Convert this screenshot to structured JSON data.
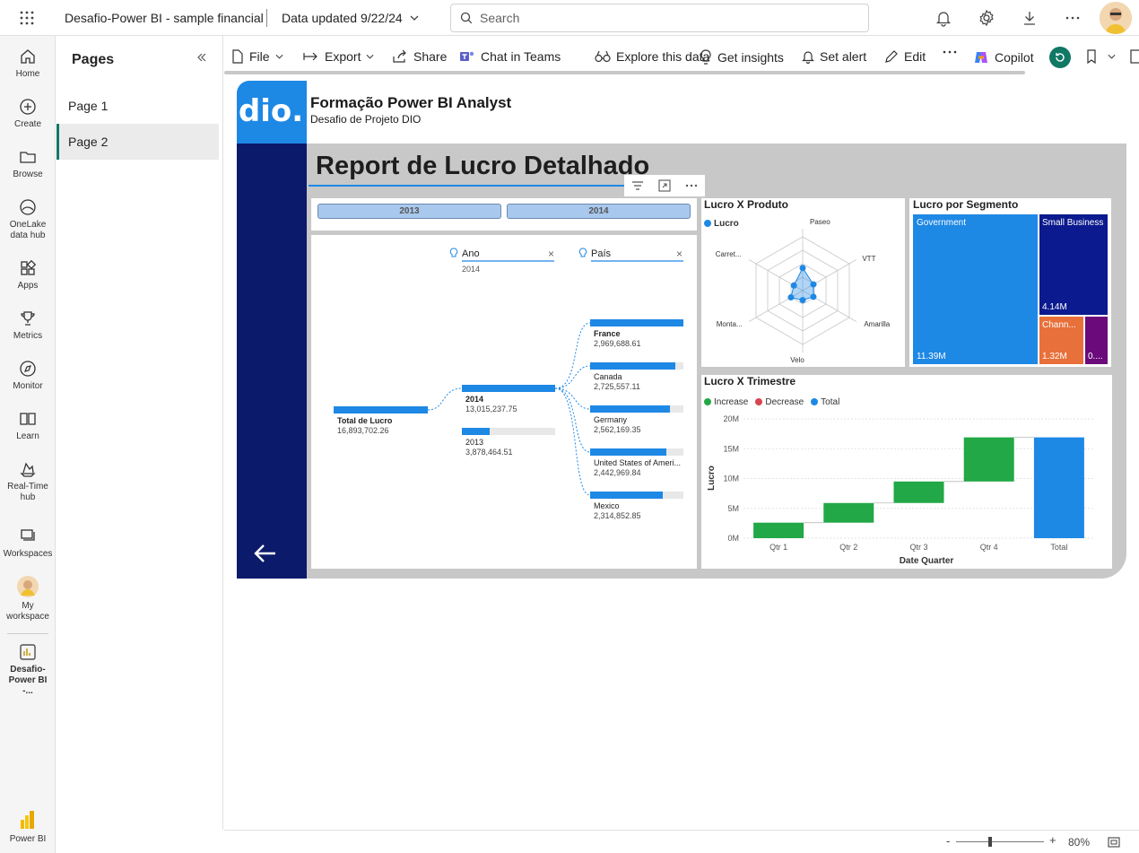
{
  "header": {
    "app_title": "Desafio-Power BI - sample financial",
    "data_updated": "Data updated 9/22/24",
    "search_placeholder": "Search"
  },
  "leftnav": {
    "items": [
      {
        "label": "Home"
      },
      {
        "label": "Create"
      },
      {
        "label": "Browse"
      },
      {
        "label": "OneLake data hub"
      },
      {
        "label": "Apps"
      },
      {
        "label": "Metrics"
      },
      {
        "label": "Monitor"
      },
      {
        "label": "Learn"
      },
      {
        "label": "Real-Time hub"
      },
      {
        "label": "Workspaces"
      },
      {
        "label": "My workspace"
      },
      {
        "label": "Desafio-Power BI -..."
      }
    ],
    "footer_label": "Power BI"
  },
  "pages": {
    "title": "Pages",
    "items": [
      {
        "label": "Page 1",
        "active": false
      },
      {
        "label": "Page 2",
        "active": true
      }
    ]
  },
  "toolbar": {
    "file": "File",
    "export": "Export",
    "share": "Share",
    "chat": "Chat in Teams",
    "explore": "Explore this data",
    "insights": "Get insights",
    "alert": "Set alert",
    "edit": "Edit",
    "copilot": "Copilot"
  },
  "report": {
    "brand_title": "Formação Power BI Analyst",
    "brand_subtitle": "Desafio de Projeto DIO",
    "logo_text": "dio.",
    "main_title": "Report de Lucro Detalhado",
    "slicer": [
      "2013",
      "2014"
    ],
    "decomp": {
      "ano_label": "Ano",
      "ano_value": "2014",
      "pais_label": "País",
      "root_label": "Total de Lucro",
      "root_value": "16,893,702.26",
      "years": [
        {
          "label": "2014",
          "value": "13,015,237.75"
        },
        {
          "label": "2013",
          "value": "3,878,464.51"
        }
      ],
      "countries": [
        {
          "label": "France",
          "value": "2,969,688.61"
        },
        {
          "label": "Canada",
          "value": "2,725,557.11"
        },
        {
          "label": "Germany",
          "value": "2,562,169.35"
        },
        {
          "label": "United States of Ameri...",
          "value": "2,442,969.84"
        },
        {
          "label": "Mexico",
          "value": "2,314,852.85"
        }
      ]
    },
    "radar": {
      "title": "Lucro X Produto",
      "legend": "Lucro",
      "axes": [
        "Paseo",
        "VTT",
        "Amarilla",
        "Velo",
        "Monta...",
        "Carret..."
      ]
    },
    "treemap": {
      "title": "Lucro por Segmento",
      "cells": [
        {
          "label": "Government",
          "value": "11.39M"
        },
        {
          "label": "Small Business",
          "value": "4.14M"
        },
        {
          "label": "Chann...",
          "value": "1.32M"
        },
        {
          "label": "",
          "value": "0...."
        }
      ]
    },
    "waterfall": {
      "title": "Lucro X Trimestre",
      "legend": [
        "Increase",
        "Decrease",
        "Total"
      ],
      "ylabel": "Lucro",
      "xlabel": "Date Quarter",
      "yticks": [
        "20M",
        "15M",
        "10M",
        "5M",
        "0M"
      ],
      "categories": [
        "Qtr 1",
        "Qtr 2",
        "Qtr 3",
        "Qtr 4",
        "Total"
      ]
    }
  },
  "status": {
    "zoom": "80%"
  },
  "colors": {
    "accent_blue": "#1e88e5",
    "navy": "#0b1a6b",
    "increase": "#22a846",
    "decrease": "#d64550",
    "total": "#1e88e5"
  },
  "chart_data": [
    {
      "type": "waterfall",
      "title": "Lucro X Trimestre",
      "categories": [
        "Qtr 1",
        "Qtr 2",
        "Qtr 3",
        "Qtr 4",
        "Total"
      ],
      "values": [
        2.6,
        3.3,
        3.6,
        7.4,
        16.9
      ],
      "xlabel": "Date Quarter",
      "ylabel": "Lucro",
      "ylim": [
        0,
        20
      ],
      "legend": [
        "Increase",
        "Decrease",
        "Total"
      ]
    },
    {
      "type": "radar",
      "title": "Lucro X Produto",
      "categories": [
        "Paseo",
        "VTT",
        "Amarilla",
        "Velo",
        "Monta...",
        "Carret..."
      ],
      "series": [
        {
          "name": "Lucro",
          "values": [
            1.0,
            0.55,
            0.55,
            0.42,
            0.6,
            0.45
          ]
        }
      ]
    },
    {
      "type": "treemap",
      "title": "Lucro por Segmento",
      "categories": [
        "Government",
        "Small Business",
        "Chann...",
        ""
      ],
      "values": [
        11.39,
        4.14,
        1.32,
        0.5
      ]
    }
  ]
}
